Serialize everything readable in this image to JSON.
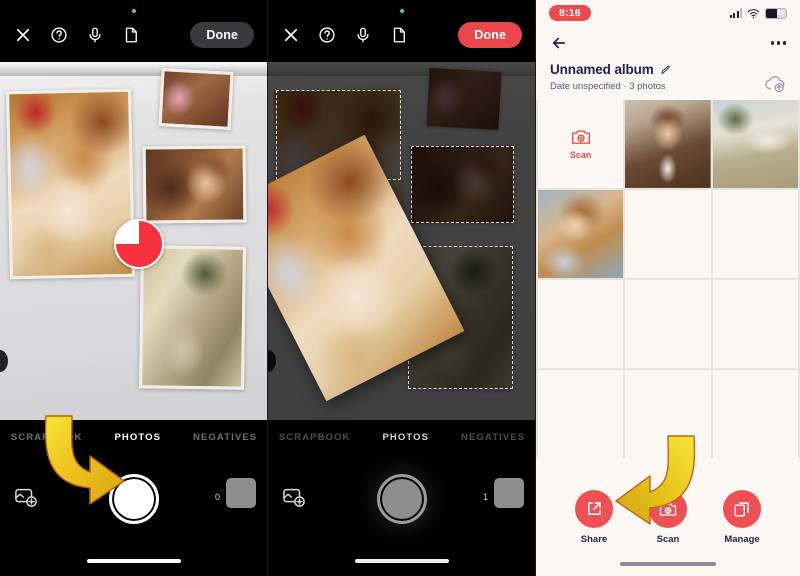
{
  "panels": {
    "left": {
      "name": "camera-scanning-scrapbook",
      "header": {
        "close_icon": "close-icon",
        "help_icon": "help-circle-icon",
        "mic_icon": "microphone-icon",
        "page_icon": "document-page-icon",
        "done_label": "Done"
      },
      "tabs": [
        {
          "label": "SCRAPBOOK",
          "active": false
        },
        {
          "label": "PHOTOS",
          "active": true
        },
        {
          "label": "NEGATIVES",
          "active": false
        }
      ],
      "controls": {
        "gallery_icon": "add-photo-icon",
        "shutter_icon": "shutter-button",
        "count": "0",
        "thumbnail": "last-capture-thumbnail"
      },
      "progress": {
        "icon": "pie-progress-indicator",
        "percent": 75
      }
    },
    "middle": {
      "name": "camera-photo-detection",
      "header": {
        "close_icon": "close-icon",
        "help_icon": "help-circle-icon",
        "mic_icon": "microphone-icon",
        "page_icon": "document-page-icon",
        "done_label": "Done"
      },
      "tabs": [
        {
          "label": "SCRAPBOOK",
          "active": false
        },
        {
          "label": "PHOTOS",
          "active": true
        },
        {
          "label": "NEGATIVES",
          "active": false
        }
      ],
      "controls": {
        "gallery_icon": "add-photo-icon",
        "shutter_icon": "shutter-button",
        "count": "1",
        "thumbnail": "last-capture-thumbnail"
      }
    },
    "right": {
      "name": "album-detail-screen",
      "status_bar": {
        "time": "8:16",
        "signal_icon": "cellular-signal-icon",
        "wifi_icon": "wifi-icon",
        "battery_icon": "battery-icon",
        "battery_percent": "43"
      },
      "nav": {
        "back_icon": "back-arrow-icon",
        "more_icon": "more-options-icon"
      },
      "album": {
        "title": "Unnamed album",
        "edit_icon": "pencil-edit-icon",
        "subtitle": "Date unspecified  ·  3 photos",
        "cloud_icon": "cloud-upload-icon"
      },
      "grid": {
        "scan_cell": {
          "icon": "scan-camera-icon",
          "label": "Scan"
        },
        "photos": [
          {
            "name": "photo-young-man-portrait"
          },
          {
            "name": "photo-house-exterior"
          },
          {
            "name": "photo-smiling-girl"
          }
        ],
        "empty_cells": 8
      },
      "actions": [
        {
          "label": "Share",
          "icon": "share-icon"
        },
        {
          "label": "Scan",
          "icon": "scan-camera-icon"
        },
        {
          "label": "Manage",
          "icon": "manage-copies-icon"
        }
      ]
    }
  },
  "annotations": {
    "arrow_left": {
      "name": "arrow-to-shutter",
      "color": "#f2d12b"
    },
    "arrow_right": {
      "name": "arrow-to-scan-button",
      "color": "#f2d12b"
    }
  }
}
